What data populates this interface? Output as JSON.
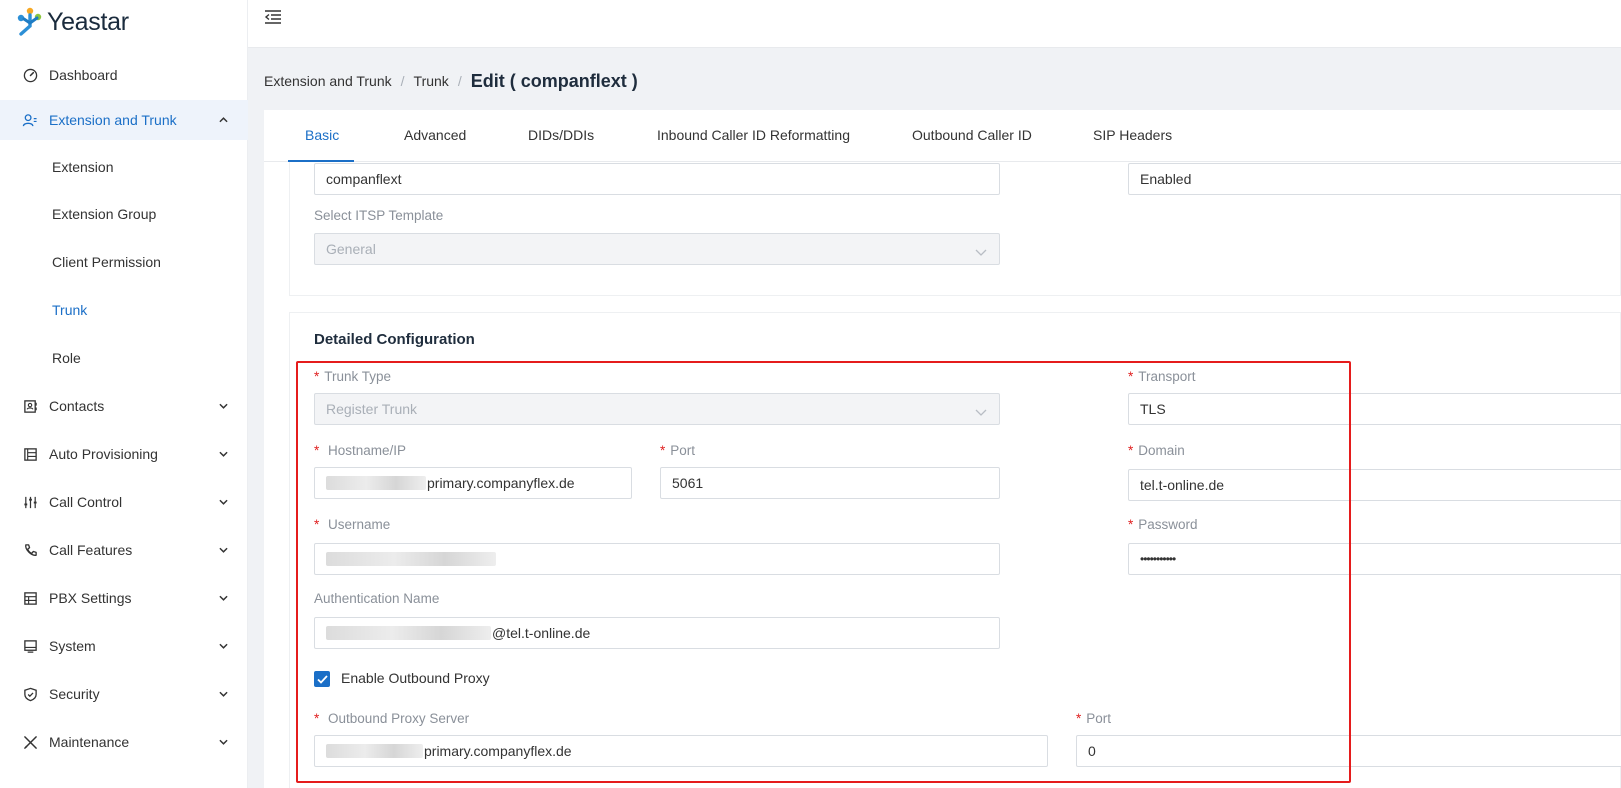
{
  "app": {
    "brand": "Yeastar",
    "colors": {
      "accent": "#1b6fc7",
      "highlight": "#e51c1c",
      "required": "#e02020"
    }
  },
  "sidebar": {
    "items": [
      {
        "label": "Dashboard",
        "icon": "gauge-icon",
        "expandable": false
      },
      {
        "label": "Extension and Trunk",
        "icon": "user-group-icon",
        "expandable": true,
        "expanded": true,
        "active": true
      },
      {
        "label": "Contacts",
        "icon": "contacts-icon",
        "expandable": true
      },
      {
        "label": "Auto Provisioning",
        "icon": "provisioning-icon",
        "expandable": true
      },
      {
        "label": "Call Control",
        "icon": "sliders-icon",
        "expandable": true
      },
      {
        "label": "Call Features",
        "icon": "phone-icon",
        "expandable": true
      },
      {
        "label": "PBX Settings",
        "icon": "settings-grid-icon",
        "expandable": true
      },
      {
        "label": "System",
        "icon": "monitor-icon",
        "expandable": true
      },
      {
        "label": "Security",
        "icon": "shield-icon",
        "expandable": true
      },
      {
        "label": "Maintenance",
        "icon": "tools-icon",
        "expandable": true
      }
    ],
    "sub_items": [
      {
        "label": "Extension"
      },
      {
        "label": "Extension Group"
      },
      {
        "label": "Client Permission"
      },
      {
        "label": "Trunk",
        "selected": true
      },
      {
        "label": "Role"
      }
    ]
  },
  "breadcrumb": {
    "items": [
      "Extension and Trunk",
      "Trunk"
    ],
    "current": "Edit ( companflext )"
  },
  "tabs": [
    {
      "label": "Basic",
      "active": true
    },
    {
      "label": "Advanced"
    },
    {
      "label": "DIDs/DDIs"
    },
    {
      "label": "Inbound Caller ID Reformatting"
    },
    {
      "label": "Outbound Caller ID"
    },
    {
      "label": "SIP Headers"
    }
  ],
  "basic": {
    "name_value": "companflext",
    "status_value": "Enabled",
    "itsp_label": "Select ITSP Template",
    "itsp_value": "General"
  },
  "detailed": {
    "title": "Detailed Configuration",
    "trunk_type_label": "Trunk Type",
    "trunk_type_value": "Register Trunk",
    "transport_label": "Transport",
    "transport_value": "TLS",
    "hostname_label": "Hostname/IP",
    "hostname_suffix": "primary.companyflex.de",
    "port_label": "Port",
    "port_value": "5061",
    "domain_label": "Domain",
    "domain_value": "tel.t-online.de",
    "username_label": "Username",
    "password_label": "Password",
    "password_value": "•••••••••••",
    "auth_name_label": "Authentication Name",
    "auth_name_suffix": "@tel.t-online.de",
    "outbound_proxy_checkbox_label": "Enable Outbound Proxy",
    "outbound_proxy_enabled": true,
    "proxy_server_label": "Outbound Proxy Server",
    "proxy_server_suffix": "primary.companyflex.de",
    "proxy_port_label": "Port",
    "proxy_port_value": "0"
  }
}
